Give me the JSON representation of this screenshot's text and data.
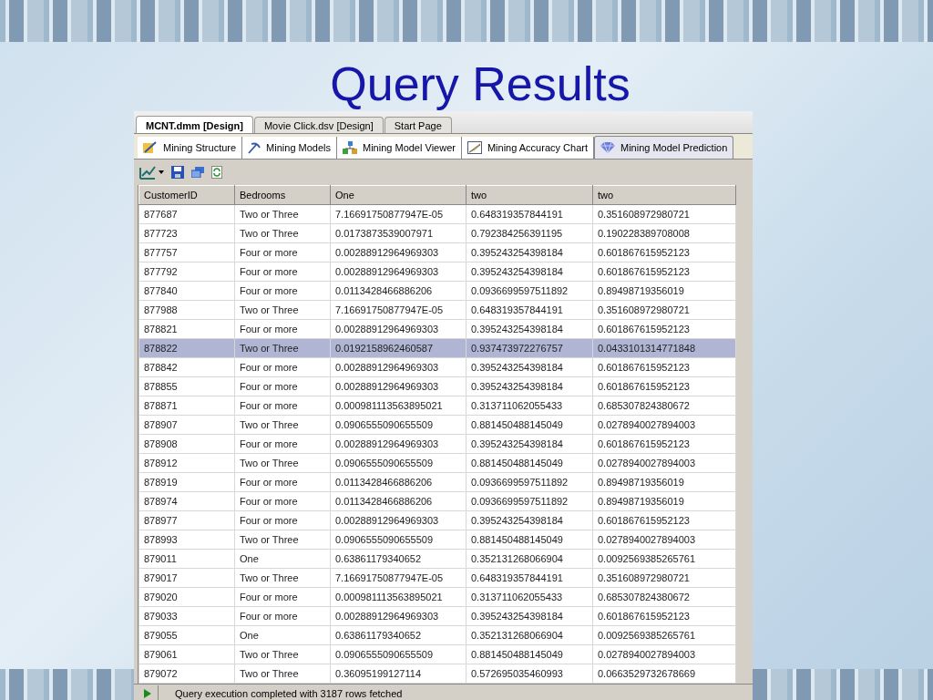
{
  "slide": {
    "title": "Query Results"
  },
  "document_tabs": [
    {
      "label": "MCNT.dmm [Design]",
      "selected": true
    },
    {
      "label": "Movie Click.dsv [Design]",
      "selected": false
    },
    {
      "label": "Start Page",
      "selected": false
    }
  ],
  "designer_tabs": [
    {
      "label": "Mining Structure",
      "kind": "structure",
      "selected": false
    },
    {
      "label": "Mining Models",
      "kind": "pick",
      "selected": false
    },
    {
      "label": "Mining Model Viewer",
      "kind": "viewer",
      "selected": false
    },
    {
      "label": "Mining Accuracy Chart",
      "kind": "chart",
      "selected": false
    },
    {
      "label": "Mining Model Prediction",
      "kind": "diamond",
      "selected": true
    }
  ],
  "table": {
    "columns": [
      "CustomerID",
      "Bedrooms",
      "One",
      "two",
      "two"
    ],
    "rows": [
      {
        "cells": [
          "877687",
          "Two or Three",
          "7.16691750877947E-05",
          "0.648319357844191",
          "0.351608972980721"
        ],
        "selected": false
      },
      {
        "cells": [
          "877723",
          "Two or Three",
          "0.0173873539007971",
          "0.792384256391195",
          "0.190228389708008"
        ],
        "selected": false
      },
      {
        "cells": [
          "877757",
          "Four or more",
          "0.00288912964969303",
          "0.395243254398184",
          "0.601867615952123"
        ],
        "selected": false
      },
      {
        "cells": [
          "877792",
          "Four or more",
          "0.00288912964969303",
          "0.395243254398184",
          "0.601867615952123"
        ],
        "selected": false
      },
      {
        "cells": [
          "877840",
          "Four or more",
          "0.0113428466886206",
          "0.0936699597511892",
          "0.89498719356019"
        ],
        "selected": false
      },
      {
        "cells": [
          "877988",
          "Two or Three",
          "7.16691750877947E-05",
          "0.648319357844191",
          "0.351608972980721"
        ],
        "selected": false
      },
      {
        "cells": [
          "878821",
          "Four or more",
          "0.00288912964969303",
          "0.395243254398184",
          "0.601867615952123"
        ],
        "selected": false
      },
      {
        "cells": [
          "878822",
          "Two or Three",
          "0.0192158962460587",
          "0.937473972276757",
          "0.0433101314771848"
        ],
        "selected": true
      },
      {
        "cells": [
          "878842",
          "Four or more",
          "0.00288912964969303",
          "0.395243254398184",
          "0.601867615952123"
        ],
        "selected": false
      },
      {
        "cells": [
          "878855",
          "Four or more",
          "0.00288912964969303",
          "0.395243254398184",
          "0.601867615952123"
        ],
        "selected": false
      },
      {
        "cells": [
          "878871",
          "Four or more",
          "0.000981113563895021",
          "0.313711062055433",
          "0.685307824380672"
        ],
        "selected": false
      },
      {
        "cells": [
          "878907",
          "Two or Three",
          "0.0906555090655509",
          "0.881450488145049",
          "0.0278940027894003"
        ],
        "selected": false
      },
      {
        "cells": [
          "878908",
          "Four or more",
          "0.00288912964969303",
          "0.395243254398184",
          "0.601867615952123"
        ],
        "selected": false
      },
      {
        "cells": [
          "878912",
          "Two or Three",
          "0.0906555090655509",
          "0.881450488145049",
          "0.0278940027894003"
        ],
        "selected": false
      },
      {
        "cells": [
          "878919",
          "Four or more",
          "0.0113428466886206",
          "0.0936699597511892",
          "0.89498719356019"
        ],
        "selected": false
      },
      {
        "cells": [
          "878974",
          "Four or more",
          "0.0113428466886206",
          "0.0936699597511892",
          "0.89498719356019"
        ],
        "selected": false
      },
      {
        "cells": [
          "878977",
          "Four or more",
          "0.00288912964969303",
          "0.395243254398184",
          "0.601867615952123"
        ],
        "selected": false
      },
      {
        "cells": [
          "878993",
          "Two or Three",
          "0.0906555090655509",
          "0.881450488145049",
          "0.0278940027894003"
        ],
        "selected": false
      },
      {
        "cells": [
          "879011",
          "One",
          "0.63861179340652",
          "0.352131268066904",
          "0.0092569385265761"
        ],
        "selected": false
      },
      {
        "cells": [
          "879017",
          "Two or Three",
          "7.16691750877947E-05",
          "0.648319357844191",
          "0.351608972980721"
        ],
        "selected": false
      },
      {
        "cells": [
          "879020",
          "Four or more",
          "0.000981113563895021",
          "0.313711062055433",
          "0.685307824380672"
        ],
        "selected": false
      },
      {
        "cells": [
          "879033",
          "Four or more",
          "0.00288912964969303",
          "0.395243254398184",
          "0.601867615952123"
        ],
        "selected": false
      },
      {
        "cells": [
          "879055",
          "One",
          "0.63861179340652",
          "0.352131268066904",
          "0.0092569385265761"
        ],
        "selected": false
      },
      {
        "cells": [
          "879061",
          "Two or Three",
          "0.0906555090655509",
          "0.881450488145049",
          "0.0278940027894003"
        ],
        "selected": false
      },
      {
        "cells": [
          "879072",
          "Two or Three",
          "0.36095199127114",
          "0.572695035460993",
          "0.0663529732678669"
        ],
        "selected": false
      }
    ]
  },
  "status_bar": {
    "message": "Query execution completed with 3187 rows fetched"
  }
}
